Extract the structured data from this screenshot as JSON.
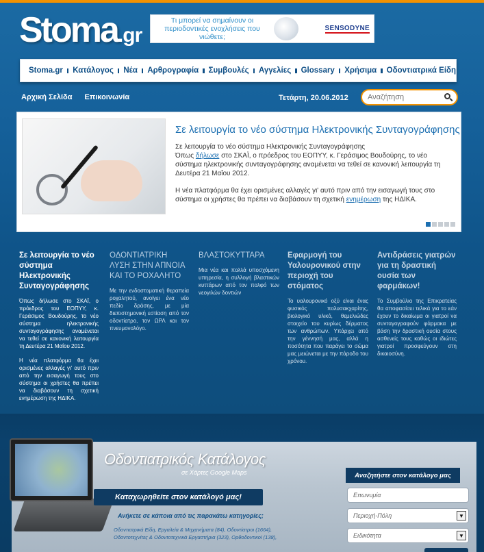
{
  "logo": {
    "main": "Stoma",
    "tld": ".gr"
  },
  "ad": {
    "text": "Τι μπορεί να σημαίνουν οι περιοδοντικές ενοχλήσεις που νιώθετε;",
    "brand": "SENSODYNE"
  },
  "nav": {
    "items": [
      "Stoma.gr",
      "Κατάλογος",
      "Νέα",
      "Αρθρογραφία",
      "Συμβουλές",
      "Αγγελίες",
      "Glossary",
      "Χρήσιμα",
      "Οδοντιατρικά Είδη"
    ]
  },
  "subnav": {
    "home": "Αρχική Σελίδα",
    "contact": "Επικοινωνία"
  },
  "date": "Τετάρτη, 20.06.2012",
  "search": {
    "placeholder": "Αναζήτηση"
  },
  "slider": {
    "title": "Σε λειτουργία το νέο σύστημα Ηλεκτρονικής Συνταγογράφησης",
    "p1_a": "Σε λειτουργία το νέο σύστημα Ηλεκτρονικής Συνταγογράφησης",
    "p1_b": "Όπως ",
    "p1_link": "δήλωσε",
    "p1_c": " στο ΣΚΑΪ, ο πρόεδρος του ΕΟΠΥΥ, κ. Γεράσιμος Βουδούρης, το νέο σύστημα ηλεκτρονικής συνταγογράφησης αναμένεται να τεθεί σε κανονική λειτουργία τη Δευτέρα 21 Μαΐου 2012.",
    "p2_a": "Η νέα πλατφόρμα θα έχει ορισμένες αλλαγές γι' αυτό πριν από την εισαγωγή τους στο σύστημα οι χρήστες θα πρέπει να διαβάσουν τη σχετική ",
    "p2_link": "ενημέρωση",
    "p2_b": " της ΗΔΙΚΑ.",
    "active_slide": 1,
    "total_slides": 5
  },
  "columns": [
    {
      "title": "Σε λειτουργία το νέο σύστημα Ηλεκτρονικής Συνταγογράφησης",
      "p1": "Όπως δήλωσε στο ΣΚΑΪ, ο πρόεδρος του ΕΟΠΥΥ, κ. Γεράσιμος Βουδούρης, το νέο σύστημα ηλεκτρονικής συνταγογράφησης αναμένεται να τεθεί σε κανονική λειτουργία τη Δευτέρα 21 Μαΐου 2012.",
      "p2": "Η νέα πλατφόρμα θα έχει ορισμένες αλλαγές γι' αυτό πριν από την εισαγωγή τους στο σύστημα οι χρήστες θα πρέπει να διαβάσουν τη σχετική ενημέρωση της ΗΔΙΚΑ."
    },
    {
      "title": "ΟΔΟΝΤΙΑΤΡΙΚΗ ΛΥΣΗ ΣΤΗΝ ΑΠΝΟΙΑ ΚΑΙ ΤΟ ΡΟΧΑΛΗΤΟ",
      "p1": "Με την ενδοστοματική θεραπεία ροχαλητού, ανοίγει ένα νέο πεδίο δράσης, με μία διεπιστημονική εστίαση από τον οδοντίατρο, τον ΩΡΛ και τον πνευμονολόγο."
    },
    {
      "title": "ΒΛΑΣΤΟΚΥΤΤΑΡΑ",
      "p1": "Μια νέα και πολλά υποσχόμενη υπηρεσία, η συλλογή βλαστικών κυττάρων από τον πολφό των νεογιλών δοντιών"
    },
    {
      "title": "Εφαρμογή του Υαλουρονικού στην περιοχή του στόματος",
      "p1": "Το υαλουρονικό οξύ είναι ένας φυσικός πολυσακχαρίτης, βιολογικό υλικό, θεμελιώδες στοιχείο του κυρίως δέρματος των ανθρώπων. Υπάρχει από την γέννησή μας, αλλά η ποσότητα που παράγει το σώμα μας μειώνεται με την πάροδο του χρόνου."
    },
    {
      "title": "Αντιδράσεις γιατρών για τη δραστική ουσία των φαρμάκων!",
      "p1": "Το Συμβούλιο της Επικρατείας θα αποφασίσει τελικά για το εάν έχουν το δικαίωμα οι γιατροί να συνταγογραφούν φάρμακα με βάση την δραστική ουσία στους ασθενείς τους καθώς οι ιδιώτες γιατροί προσφεύγουν στη δικαιοσύνη."
    }
  ],
  "catalog": {
    "title": "Οδοντιατρικός Κατάλογος",
    "subtitle": "σε Χάρτες Google Maps",
    "register": "Καταχωρηθείτε στον κατάλογό μας!",
    "categories_label": "Ανήκετε σε κάποια από τις παρακάτω κατηγορίες;",
    "categories_text": "Οδοντιατρικά Είδη, Εργαλεία & Μηχανήματα (84), Οδοντίατροι (1664), Οδοντοτεχνίτες & Οδοντοτεχνικά Εργαστήρια (323), Ορθοδοντικοί (138),",
    "search_head": "Αναζητήστε στον κατάλογο μας",
    "field_name": "Επωνυμία",
    "field_area": "Περιοχή-Πόλη",
    "field_specialty": "Ειδικότητα"
  },
  "colors": {
    "accent": "#f39200",
    "link": "#1c6fb1",
    "nav_text": "#0f4f86",
    "background": "#0e4d7c"
  }
}
